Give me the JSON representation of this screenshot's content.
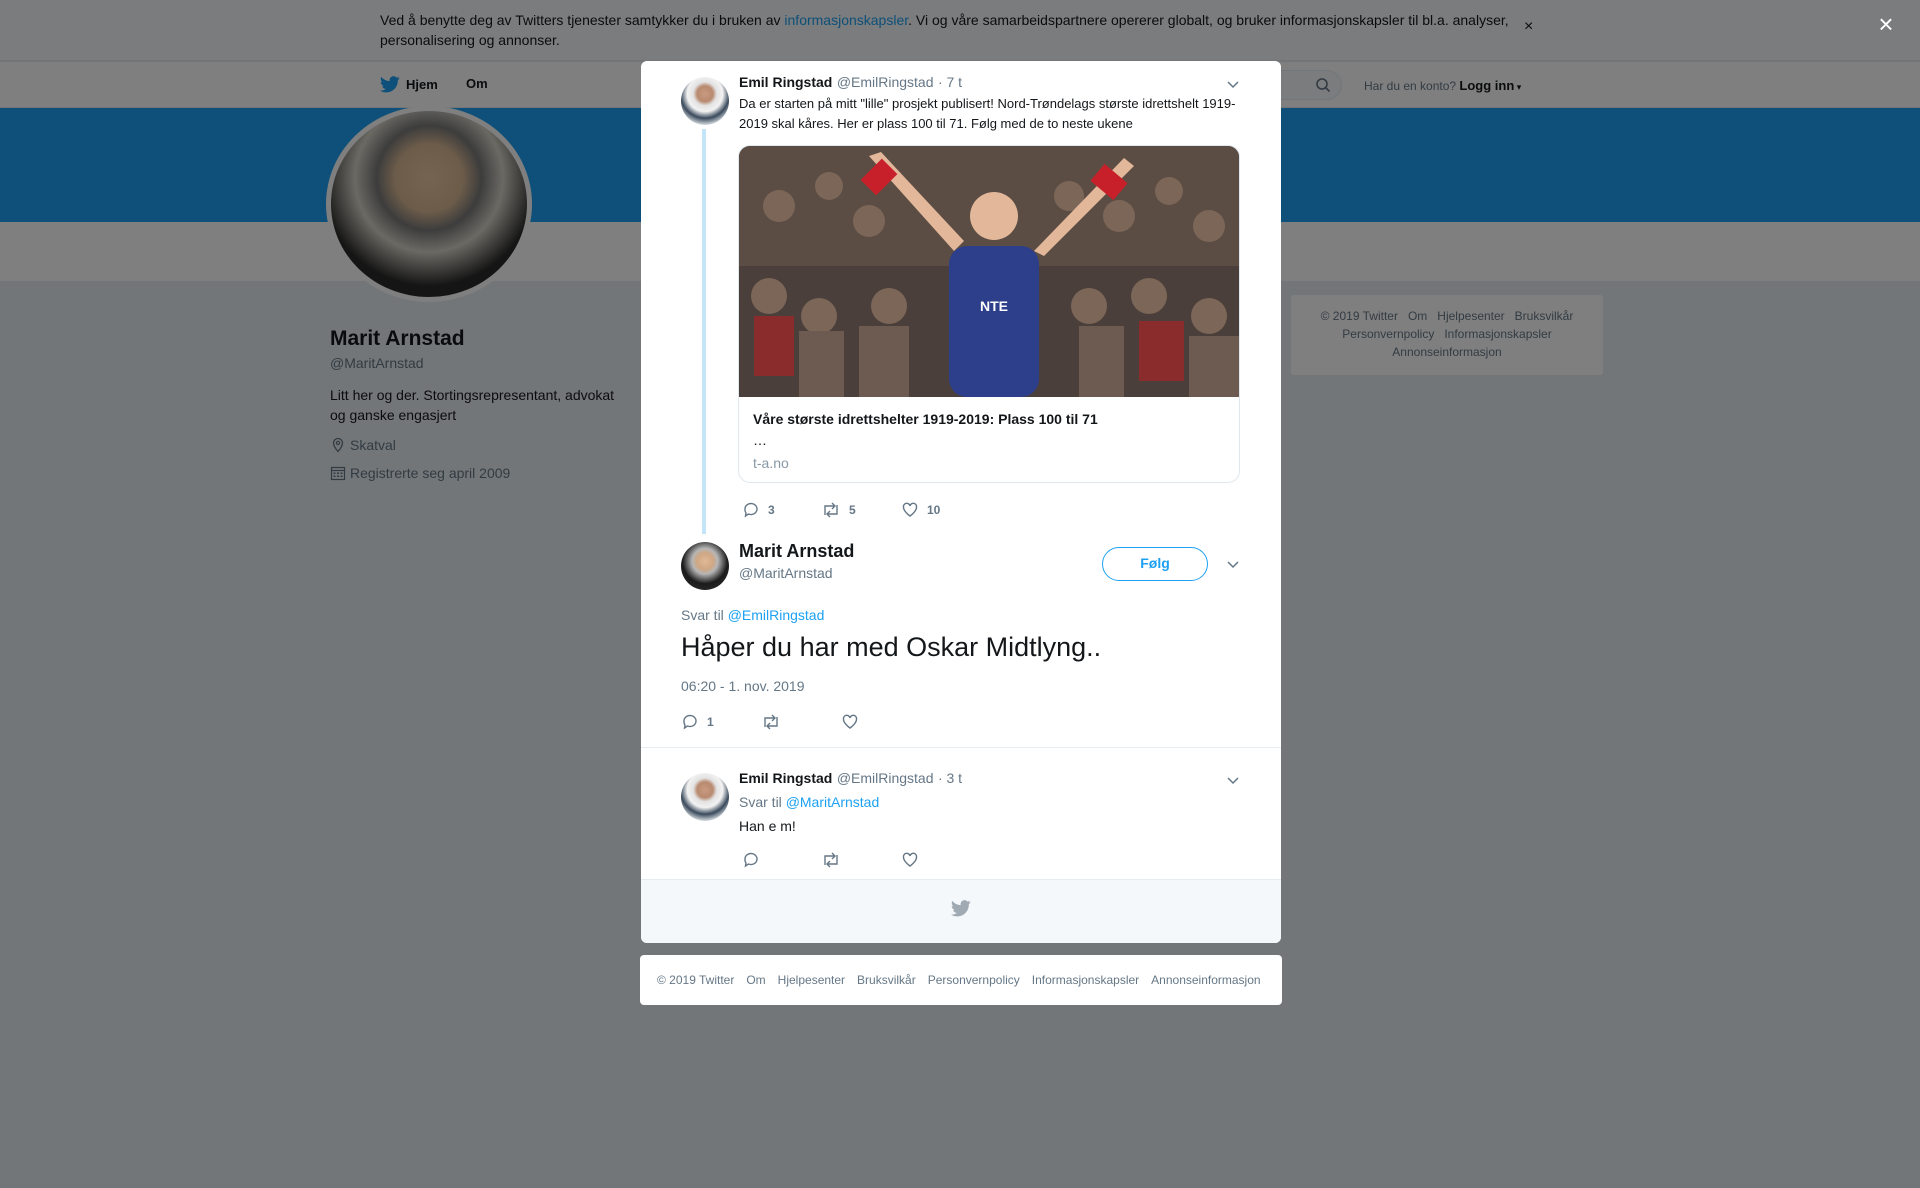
{
  "cookie": {
    "text_before": "Ved å benytte deg av Twitters tjenester samtykker du i bruken av ",
    "link": "informasjonskapsler",
    "text_after": ". Vi og våre samarbeidspartnere opererer globalt, og bruker informasjonskapsler til bl.a. analyser, personalisering og annonser.",
    "close": "×"
  },
  "nav": {
    "home": "Hjem",
    "about": "Om",
    "login_prompt": "Har du en konto?",
    "login": "Logg inn"
  },
  "profile": {
    "name": "Marit Arnstad",
    "handle": "@MaritArnstad",
    "bio": "Litt her og der. Stortingsrepresentant, advokat og ganske engasjert",
    "location": "Skatval",
    "joined": "Registrerte seg april 2009"
  },
  "side_footer": [
    "© 2019 Twitter",
    "Om",
    "Hjelpesenter",
    "Bruksvilkår",
    "Personvernpolicy",
    "Informasjonskapsler",
    "Annonseinformasjon"
  ],
  "overlay_close": "×",
  "tweet1": {
    "name": "Emil Ringstad",
    "handle": "@EmilRingstad",
    "time": "· 7 t",
    "text": "Da er starten på mitt \"lille\" prosjekt publisert! Nord-Trøndelags største idrettshelt 1919-2019 skal kåres. Her er plass 100 til 71. Følg med de to neste ukene",
    "card_title": "Våre største idrettshelter 1919-2019: Plass 100 til 71",
    "card_desc": "…",
    "card_domain": "t-a.no",
    "replies": "3",
    "retweets": "5",
    "likes": "10"
  },
  "main": {
    "name": "Marit Arnstad",
    "handle": "@MaritArnstad",
    "follow": "Følg",
    "reply_prefix": "Svar til",
    "reply_to": "@EmilRingstad",
    "text": "Håper du har med Oskar Midtlyng..",
    "time": "06:20 - 1. nov. 2019",
    "replies": "1"
  },
  "tweet3": {
    "name": "Emil Ringstad",
    "handle": "@EmilRingstad",
    "time": "· 3 t",
    "reply_prefix": "Svar til",
    "reply_to": "@MaritArnstad",
    "text": "Han e m!"
  },
  "bottom_footer": [
    "© 2019 Twitter",
    "Om",
    "Hjelpesenter",
    "Bruksvilkår",
    "Personvernpolicy",
    "Informasjonskapsler",
    "Annonseinformasjon"
  ],
  "colors": {
    "brand": "#1da1f2",
    "muted": "#657786"
  }
}
